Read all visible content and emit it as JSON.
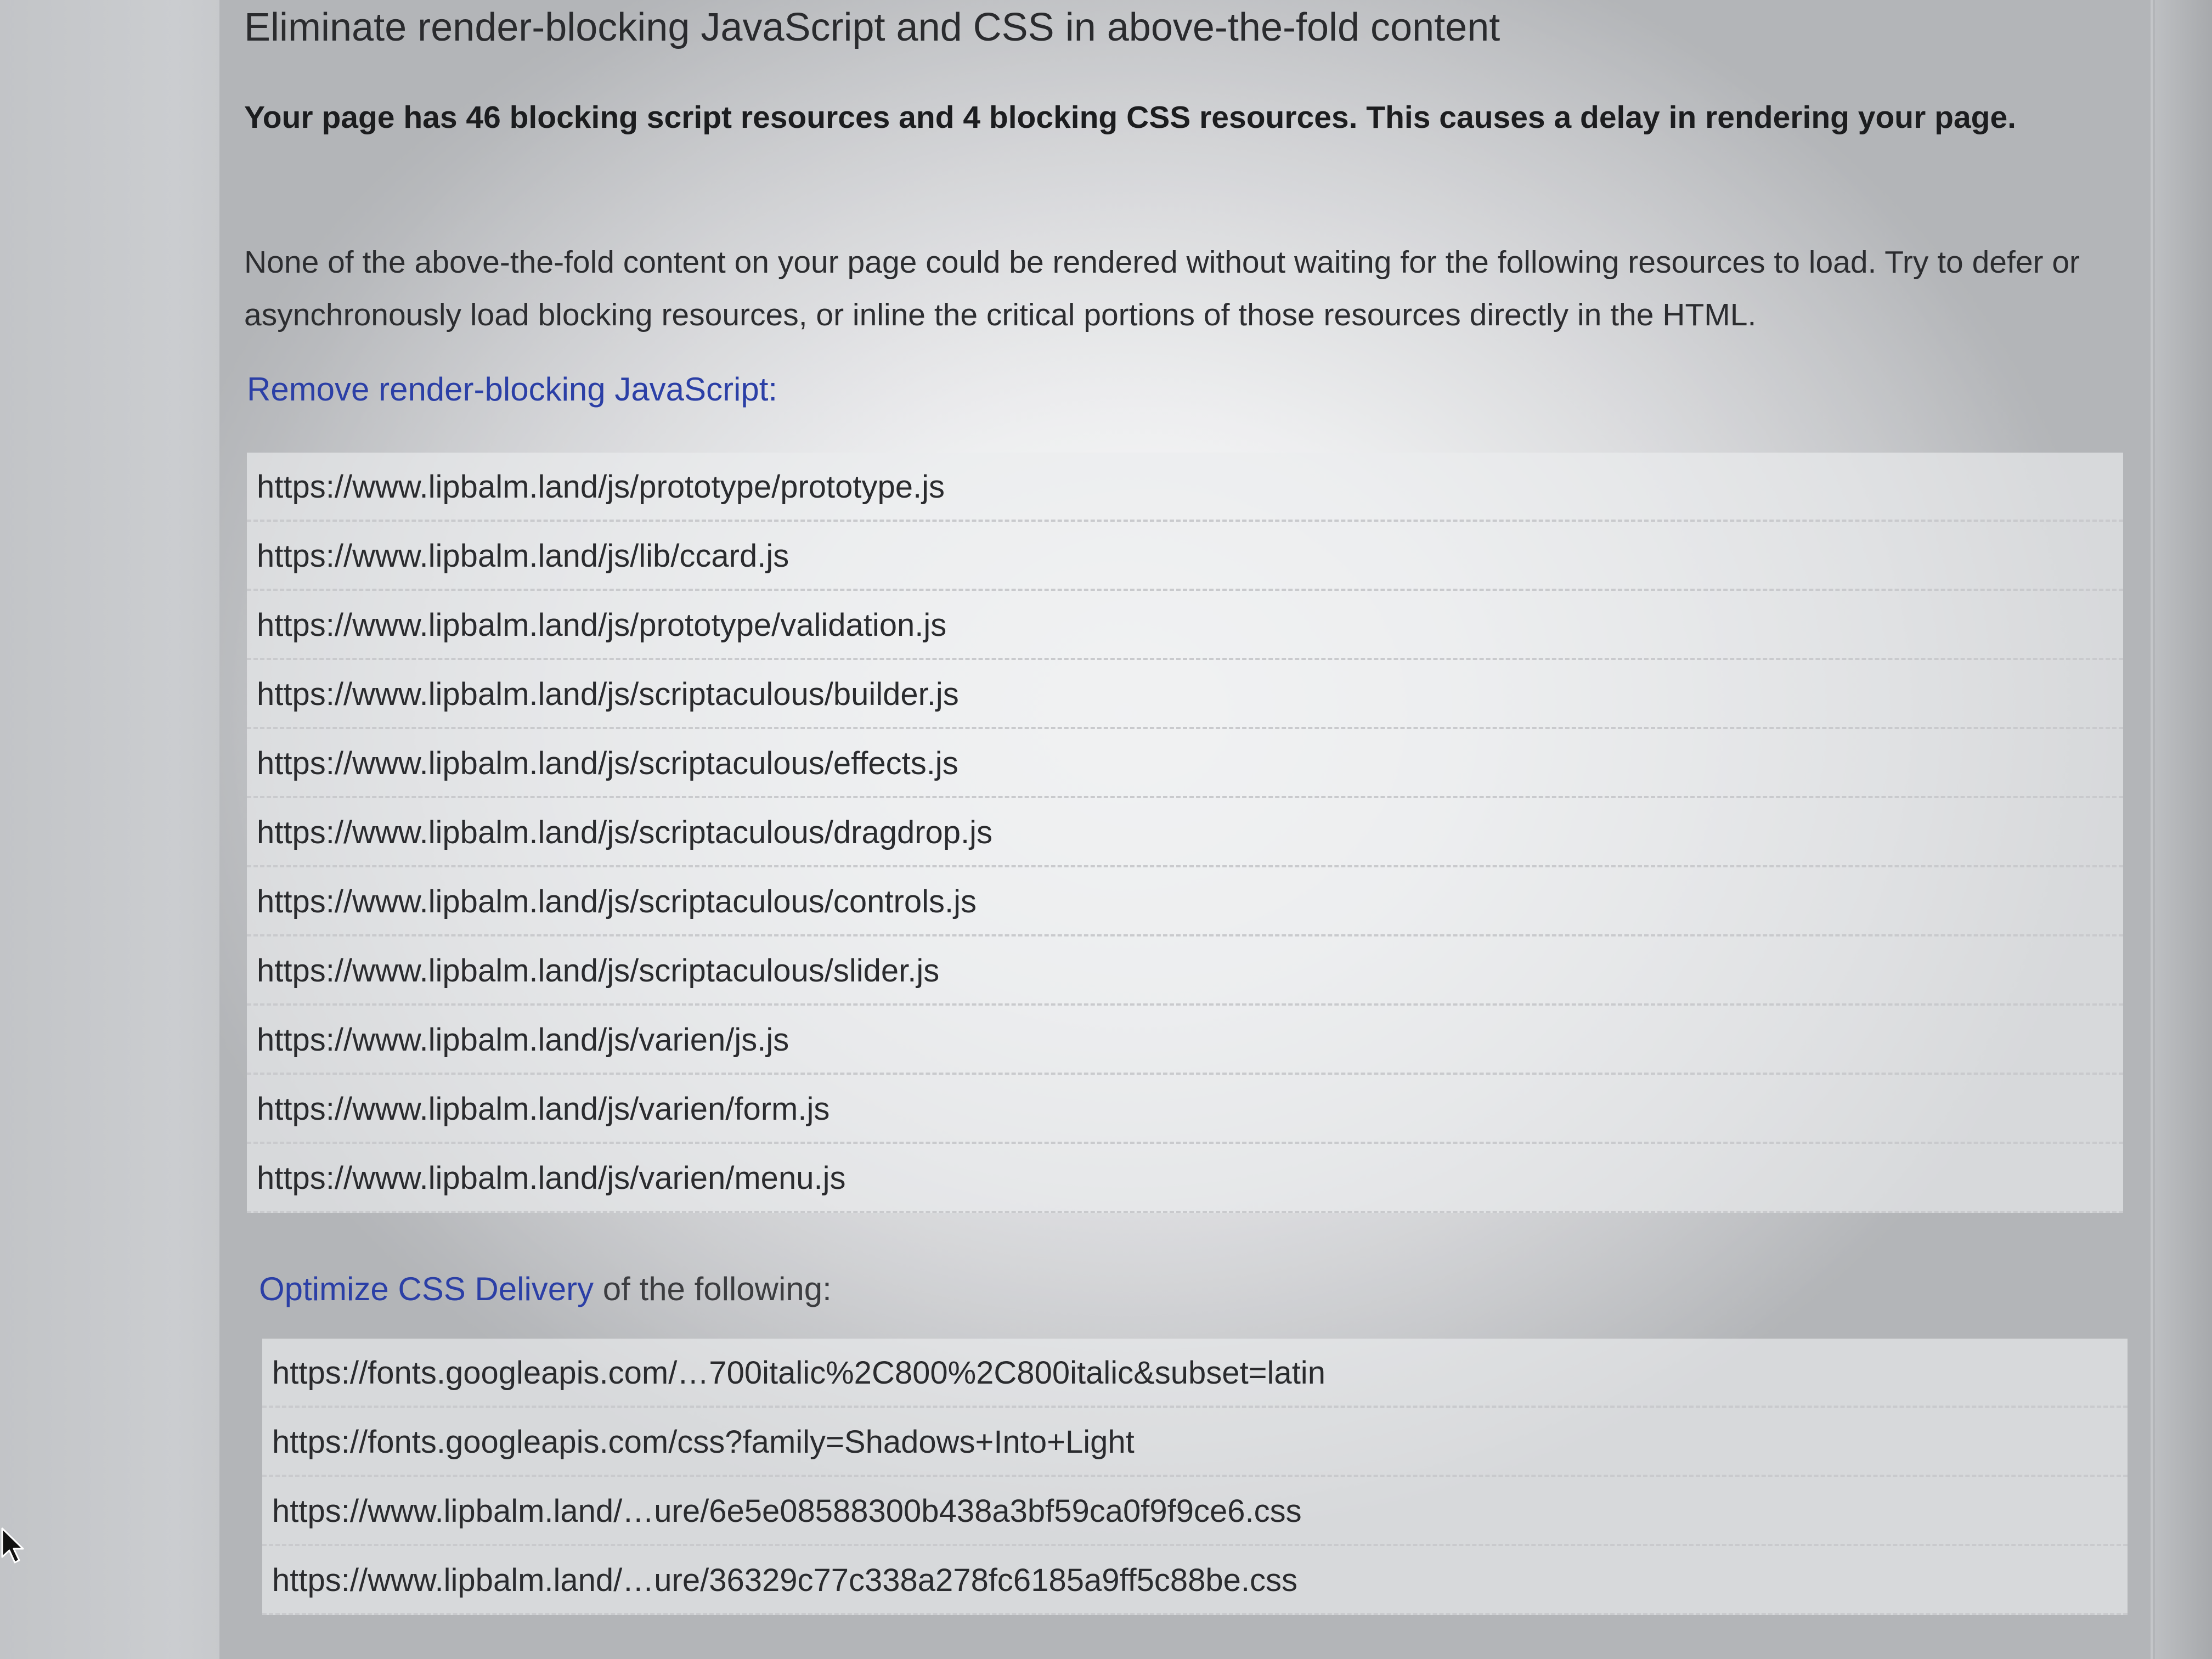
{
  "report": {
    "title": "Eliminate render-blocking JavaScript and CSS in above-the-fold content",
    "summary": "Your page has 46 blocking script resources and 4 blocking CSS resources. This causes a delay in rendering your page.",
    "description": "None of the above-the-fold content on your page could be rendered without waiting for the following resources to load. Try to defer or asynchronously load blocking resources, or inline the critical portions of those resources directly in the HTML."
  },
  "js_section": {
    "link_text": "Remove render-blocking JavaScript",
    "suffix": ":",
    "resources": [
      "https://www.lipbalm.land/js/prototype/prototype.js",
      "https://www.lipbalm.land/js/lib/ccard.js",
      "https://www.lipbalm.land/js/prototype/validation.js",
      "https://www.lipbalm.land/js/scriptaculous/builder.js",
      "https://www.lipbalm.land/js/scriptaculous/effects.js",
      "https://www.lipbalm.land/js/scriptaculous/dragdrop.js",
      "https://www.lipbalm.land/js/scriptaculous/controls.js",
      "https://www.lipbalm.land/js/scriptaculous/slider.js",
      "https://www.lipbalm.land/js/varien/js.js",
      "https://www.lipbalm.land/js/varien/form.js",
      "https://www.lipbalm.land/js/varien/menu.js"
    ]
  },
  "css_section": {
    "link_text": "Optimize CSS Delivery",
    "suffix": " of the following:",
    "resources": [
      "https://fonts.googleapis.com/…700italic%2C800%2C800italic&subset=latin",
      "https://fonts.googleapis.com/css?family=Shadows+Into+Light",
      "https://www.lipbalm.land/…ure/6e5e08588300b438a3bf59ca0f9f9ce6.css",
      "https://www.lipbalm.land/…ure/36329c77c338a278fc6185a9ff5c88be.css"
    ]
  },
  "colors": {
    "link": "#2b3fa6",
    "text": "#2a2b2e"
  },
  "icons": {
    "pointer": "mouse-pointer-icon"
  }
}
